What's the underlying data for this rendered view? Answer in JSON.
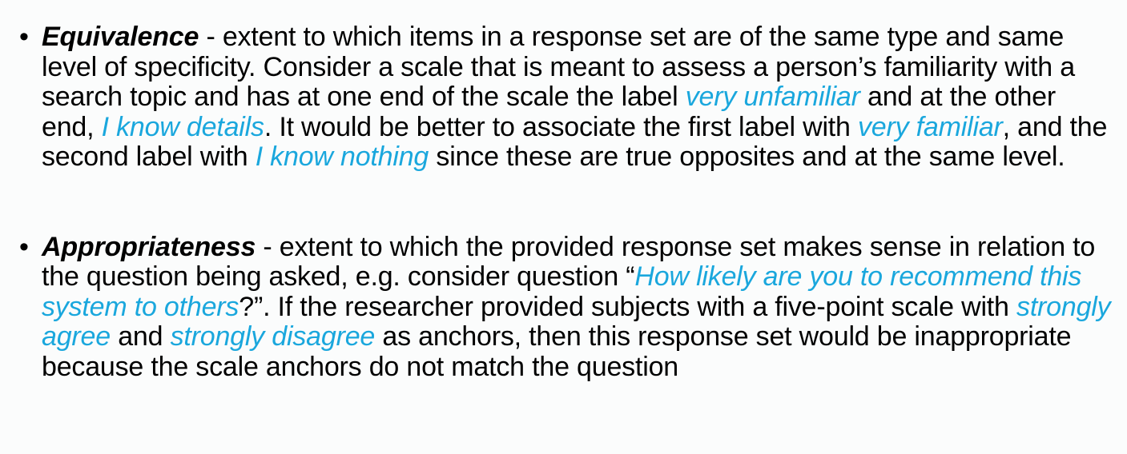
{
  "bullet_glyph": "•",
  "colors": {
    "text": "#000000",
    "highlight": "#1aa7dd",
    "background": "#fbfcfc"
  },
  "bullets": [
    {
      "term": "Equivalence",
      "segments": [
        {
          "text": " - extent to which items in a response set are of the same type and same level of specificity. Consider a scale that is meant to assess a person’s familiarity with a search topic and has at one end of the scale the label ",
          "highlight": false
        },
        {
          "text": "very unfamiliar",
          "highlight": true
        },
        {
          "text": " and at the other end, ",
          "highlight": false
        },
        {
          "text": "I know details",
          "highlight": true
        },
        {
          "text": ". It would be better to associate the first label with ",
          "highlight": false
        },
        {
          "text": "very familiar",
          "highlight": true
        },
        {
          "text": ", and the second label with ",
          "highlight": false
        },
        {
          "text": "I know nothing",
          "highlight": true
        },
        {
          "text": " since these are true opposites and at the same level.",
          "highlight": false
        }
      ]
    },
    {
      "term": "Appropriateness",
      "segments": [
        {
          "text": " - extent to which the provided response set makes sense in relation to the question being asked, e.g. consider question “",
          "highlight": false
        },
        {
          "text": "How likely are you to recommend this system to others",
          "highlight": true
        },
        {
          "text": "?”. If the researcher provided subjects with a five-point scale with ",
          "highlight": false
        },
        {
          "text": "strongly agree",
          "highlight": true
        },
        {
          "text": " and ",
          "highlight": false
        },
        {
          "text": "strongly disagree",
          "highlight": true
        },
        {
          "text": " as anchors, then this response set would be inappropriate because the scale anchors do not match the question",
          "highlight": false
        }
      ]
    }
  ]
}
